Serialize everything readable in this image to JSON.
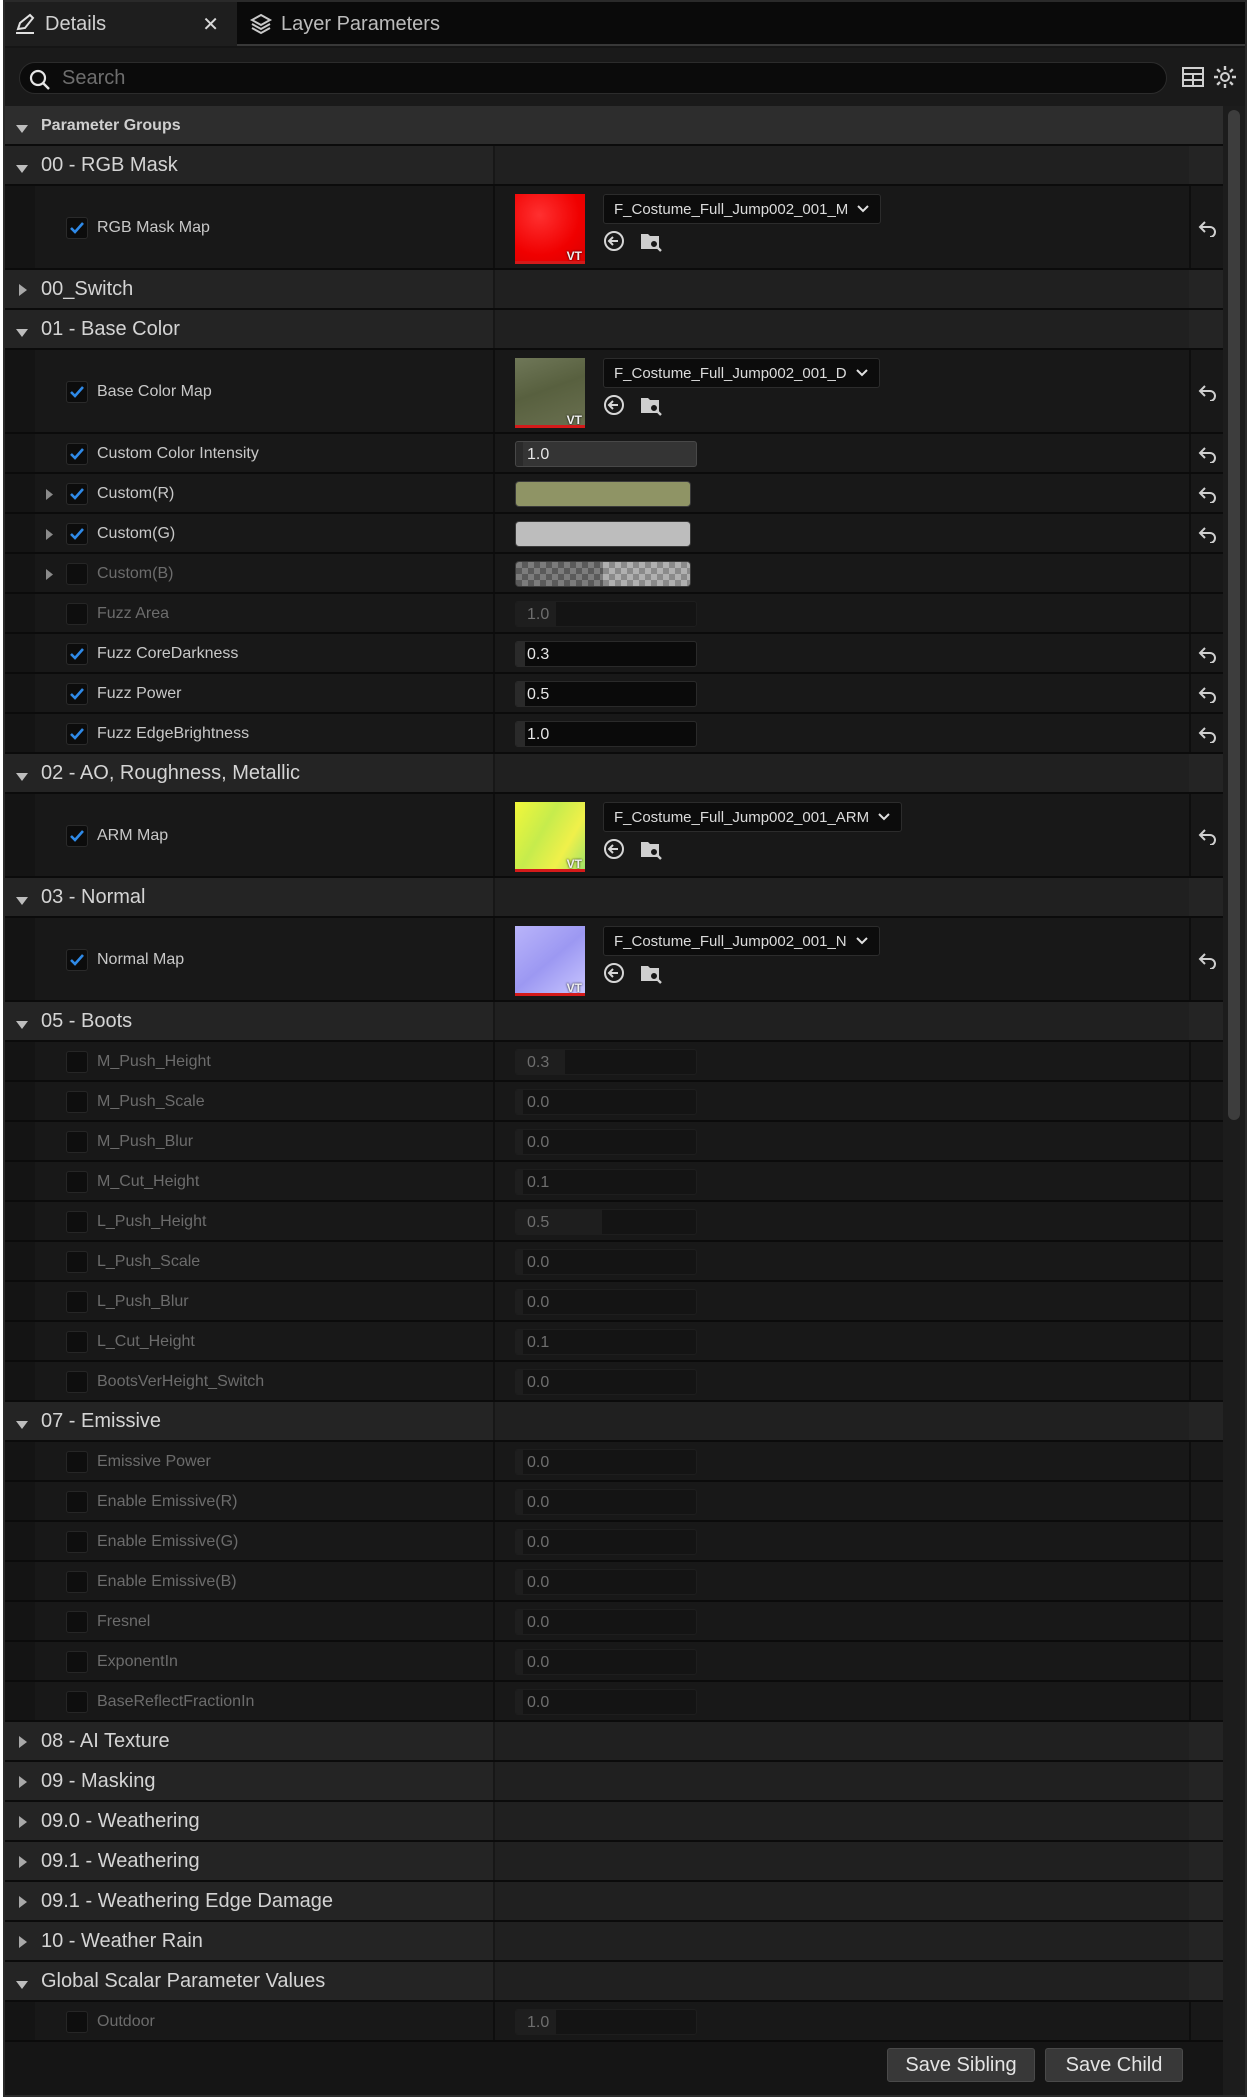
{
  "tabs": [
    {
      "label": "Details",
      "icon": "pencil-icon",
      "active": true
    },
    {
      "label": "Layer Parameters",
      "icon": "layers-icon",
      "active": false
    }
  ],
  "search": {
    "placeholder": "Search",
    "value": ""
  },
  "toolbar_icons": [
    "table-view-icon",
    "gear-icon"
  ],
  "rows": [
    {
      "type": "pg",
      "label": "Parameter Groups"
    },
    {
      "type": "group",
      "label": "00 - RGB Mask",
      "expanded": true
    },
    {
      "type": "texture",
      "label": "RGB Mask Map",
      "checked": true,
      "asset": "F_Costume_Full_Jump002_001_M",
      "thumb": "red",
      "reset": true
    },
    {
      "type": "group",
      "label": "00_Switch",
      "expanded": false
    },
    {
      "type": "group",
      "label": "01 - Base Color",
      "expanded": true
    },
    {
      "type": "texture",
      "label": "Base Color Map",
      "checked": true,
      "asset": "F_Costume_Full_Jump002_001_D",
      "thumb": "olive",
      "reset": true
    },
    {
      "type": "scalar",
      "label": "Custom Color Intensity",
      "checked": true,
      "value": "1.0",
      "style": "bright",
      "reset": true
    },
    {
      "type": "color",
      "label": "Custom(R)",
      "checked": true,
      "arrow": true,
      "color": "#8f9465",
      "reset": true
    },
    {
      "type": "color",
      "label": "Custom(G)",
      "checked": true,
      "arrow": true,
      "color": "#bdbdbd",
      "reset": true
    },
    {
      "type": "color",
      "label": "Custom(B)",
      "checked": false,
      "arrow": true,
      "color": "checker",
      "reset": false
    },
    {
      "type": "scalar",
      "label": "Fuzz Area",
      "checked": false,
      "value": "1.0",
      "fill": 0.22,
      "reset": false
    },
    {
      "type": "scalar",
      "label": "Fuzz CoreDarkness",
      "checked": true,
      "value": "0.3",
      "reset": true
    },
    {
      "type": "scalar",
      "label": "Fuzz Power",
      "checked": true,
      "value": "0.5",
      "reset": true
    },
    {
      "type": "scalar",
      "label": "Fuzz EdgeBrightness",
      "checked": true,
      "value": "1.0",
      "reset": true
    },
    {
      "type": "group",
      "label": "02 - AO, Roughness, Metallic",
      "expanded": true
    },
    {
      "type": "texture",
      "label": "ARM Map",
      "checked": true,
      "asset": "F_Costume_Full_Jump002_001_ARM",
      "thumb": "yellow",
      "reset": true
    },
    {
      "type": "group",
      "label": "03 - Normal",
      "expanded": true
    },
    {
      "type": "texture",
      "label": "Normal Map",
      "checked": true,
      "asset": "F_Costume_Full_Jump002_001_N",
      "thumb": "blue",
      "reset": true
    },
    {
      "type": "group",
      "label": "05 - Boots",
      "expanded": true
    },
    {
      "type": "scalar",
      "label": "M_Push_Height",
      "checked": false,
      "value": "0.3",
      "fill": 0.27,
      "reset": false
    },
    {
      "type": "scalar",
      "label": "M_Push_Scale",
      "checked": false,
      "value": "0.0",
      "reset": false
    },
    {
      "type": "scalar",
      "label": "M_Push_Blur",
      "checked": false,
      "value": "0.0",
      "reset": false
    },
    {
      "type": "scalar",
      "label": "M_Cut_Height",
      "checked": false,
      "value": "0.1",
      "reset": false
    },
    {
      "type": "scalar",
      "label": "L_Push_Height",
      "checked": false,
      "value": "0.5",
      "fill": 0.48,
      "reset": false
    },
    {
      "type": "scalar",
      "label": "L_Push_Scale",
      "checked": false,
      "value": "0.0",
      "reset": false
    },
    {
      "type": "scalar",
      "label": "L_Push_Blur",
      "checked": false,
      "value": "0.0",
      "reset": false
    },
    {
      "type": "scalar",
      "label": "L_Cut_Height",
      "checked": false,
      "value": "0.1",
      "reset": false
    },
    {
      "type": "scalar",
      "label": "BootsVerHeight_Switch",
      "checked": false,
      "value": "0.0",
      "reset": false
    },
    {
      "type": "group",
      "label": "07 - Emissive",
      "expanded": true
    },
    {
      "type": "scalar",
      "label": "Emissive Power",
      "checked": false,
      "value": "0.0",
      "reset": false
    },
    {
      "type": "scalar",
      "label": "Enable Emissive(R)",
      "checked": false,
      "value": "0.0",
      "reset": false
    },
    {
      "type": "scalar",
      "label": "Enable Emissive(G)",
      "checked": false,
      "value": "0.0",
      "reset": false
    },
    {
      "type": "scalar",
      "label": "Enable Emissive(B)",
      "checked": false,
      "value": "0.0",
      "reset": false
    },
    {
      "type": "scalar",
      "label": "Fresnel",
      "checked": false,
      "value": "0.0",
      "reset": false
    },
    {
      "type": "scalar",
      "label": "ExponentIn",
      "checked": false,
      "value": "0.0",
      "reset": false
    },
    {
      "type": "scalar",
      "label": "BaseReflectFractionIn",
      "checked": false,
      "value": "0.0",
      "reset": false
    },
    {
      "type": "group",
      "label": "08 - AI Texture",
      "expanded": false
    },
    {
      "type": "group",
      "label": "09 - Masking",
      "expanded": false
    },
    {
      "type": "group",
      "label": "09.0 - Weathering",
      "expanded": false
    },
    {
      "type": "group",
      "label": "09.1 - Weathering",
      "expanded": false
    },
    {
      "type": "group",
      "label": "09.1 - Weathering Edge Damage",
      "expanded": false
    },
    {
      "type": "group",
      "label": "10 - Weather Rain",
      "expanded": false
    },
    {
      "type": "group",
      "label": "Global Scalar Parameter Values",
      "expanded": true
    },
    {
      "type": "scalar",
      "label": "Outdoor",
      "checked": false,
      "value": "1.0",
      "fill": 0.22,
      "reset": false
    }
  ],
  "footer": {
    "save_sibling": "Save Sibling",
    "save_child": "Save Child"
  },
  "colors": {
    "accent_check": "#2f8ae8",
    "panel_bg": "#151515"
  }
}
